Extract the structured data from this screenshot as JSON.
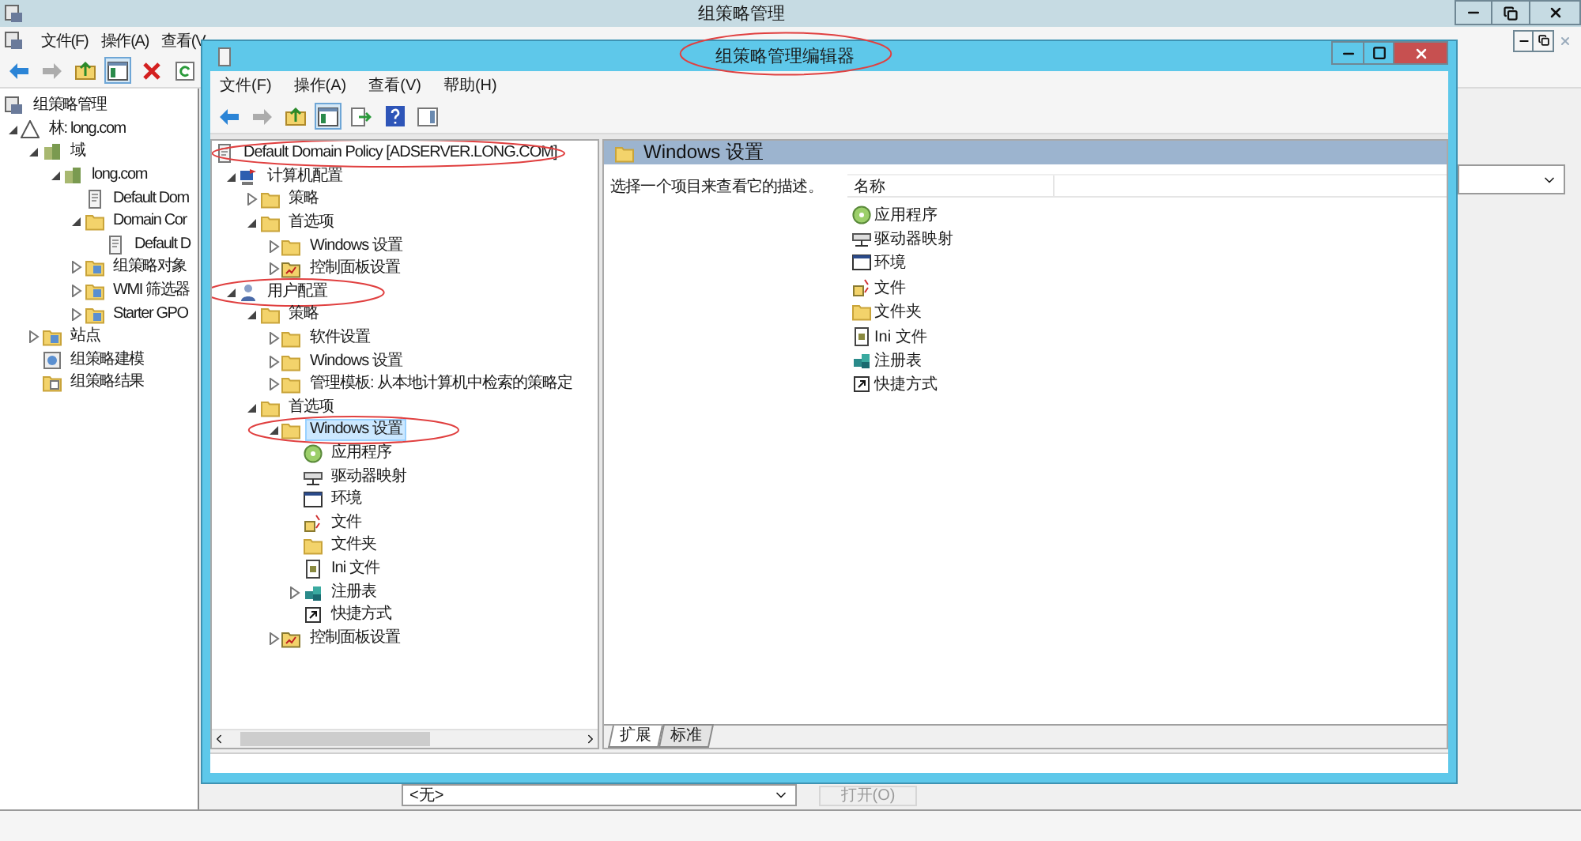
{
  "background_window": {
    "title": "组策略管理",
    "menu": [
      "文件(F)",
      "操作(A)",
      "查看(V"
    ],
    "toolbar": [
      {
        "kind": "back",
        "disabled": false,
        "pressed": false
      },
      {
        "kind": "forward",
        "disabled": true,
        "pressed": false
      },
      {
        "kind": "up",
        "disabled": false,
        "pressed": false
      },
      {
        "kind": "tree",
        "disabled": false,
        "pressed": true
      },
      {
        "kind": "delete",
        "disabled": false,
        "pressed": false
      },
      {
        "kind": "refresh",
        "disabled": false,
        "pressed": false
      }
    ],
    "tree": [
      {
        "label": "组策略管理",
        "kind": "console",
        "children": [
          {
            "label": "林: long.com",
            "kind": "forest",
            "expanded": true,
            "children": [
              {
                "label": "域",
                "kind": "domains",
                "expanded": true,
                "children": [
                  {
                    "label": "long.com",
                    "kind": "domain",
                    "expanded": true,
                    "children": [
                      {
                        "label": "Default Dom",
                        "kind": "gpo-link"
                      },
                      {
                        "label": "Domain Cor",
                        "kind": "ou",
                        "expanded": true,
                        "children": [
                          {
                            "label": "Default D",
                            "kind": "gpo-link"
                          }
                        ]
                      },
                      {
                        "label": "组策略对象",
                        "kind": "gpo-folder",
                        "expanded": false
                      },
                      {
                        "label": "WMI 筛选器",
                        "kind": "wmi",
                        "expanded": false
                      },
                      {
                        "label": "Starter GPO",
                        "kind": "starter",
                        "expanded": false
                      }
                    ]
                  }
                ]
              },
              {
                "label": "站点",
                "kind": "sites",
                "expanded": false
              },
              {
                "label": "组策略建模",
                "kind": "modeling"
              },
              {
                "label": "组策略结果",
                "kind": "results"
              }
            ]
          }
        ]
      }
    ],
    "filter_select": {
      "value": "<无>"
    },
    "open_button": {
      "label": "打开(O)",
      "disabled": true
    }
  },
  "editor_window": {
    "title": {
      "text": "组策略管理编辑器",
      "circled": true
    },
    "menu": [
      "文件(F)",
      "操作(A)",
      "查看(V)",
      "帮助(H)"
    ],
    "toolbar": [
      {
        "kind": "back",
        "disabled": false,
        "pressed": false
      },
      {
        "kind": "forward",
        "disabled": true,
        "pressed": false
      },
      {
        "kind": "up",
        "disabled": false,
        "pressed": false
      },
      {
        "kind": "tree",
        "disabled": false,
        "pressed": true
      },
      {
        "kind": "export",
        "disabled": false,
        "pressed": false
      },
      {
        "kind": "help",
        "disabled": false,
        "pressed": false
      },
      {
        "kind": "pane",
        "disabled": false,
        "pressed": false
      }
    ],
    "tree": [
      {
        "label": "Default Domain Policy [ADSERVER.LONG.COM]",
        "kind": "policy",
        "selected": false,
        "circled": true,
        "children": [
          {
            "label": "计算机配置",
            "kind": "computer",
            "expanded": true,
            "selected": false,
            "children": [
              {
                "label": "策略",
                "kind": "folder",
                "expanded": false,
                "selected": false
              },
              {
                "label": "首选项",
                "kind": "folder",
                "expanded": true,
                "selected": false,
                "children": [
                  {
                    "label": "Windows 设置",
                    "kind": "folder",
                    "expanded": false,
                    "selected": false
                  },
                  {
                    "label": "控制面板设置",
                    "kind": "control-panel",
                    "expanded": false,
                    "selected": false
                  }
                ]
              }
            ]
          },
          {
            "label": "用户配置",
            "kind": "user",
            "expanded": true,
            "selected": false,
            "circled": true,
            "children": [
              {
                "label": "策略",
                "kind": "folder",
                "expanded": true,
                "selected": false,
                "children": [
                  {
                    "label": "软件设置",
                    "kind": "folder",
                    "expanded": false,
                    "selected": false
                  },
                  {
                    "label": "Windows 设置",
                    "kind": "folder",
                    "expanded": false,
                    "selected": false
                  },
                  {
                    "label": "管理模板: 从本地计算机中检索的策略定",
                    "kind": "folder",
                    "expanded": false,
                    "selected": false
                  }
                ]
              },
              {
                "label": "首选项",
                "kind": "folder",
                "expanded": true,
                "selected": false,
                "children": [
                  {
                    "label": "Windows 设置",
                    "kind": "folder",
                    "expanded": true,
                    "selected": true,
                    "circled": true,
                    "children": [
                      {
                        "label": "应用程序",
                        "kind": "app",
                        "selected": false
                      },
                      {
                        "label": "驱动器映射",
                        "kind": "drive",
                        "selected": false
                      },
                      {
                        "label": "环境",
                        "kind": "env",
                        "selected": false
                      },
                      {
                        "label": "文件",
                        "kind": "file",
                        "selected": false
                      },
                      {
                        "label": "文件夹",
                        "kind": "folder-item",
                        "selected": false
                      },
                      {
                        "label": "Ini 文件",
                        "kind": "ini",
                        "selected": false
                      },
                      {
                        "label": "注册表",
                        "kind": "registry",
                        "expanded": false,
                        "selected": false
                      },
                      {
                        "label": "快捷方式",
                        "kind": "shortcut",
                        "selected": false
                      }
                    ]
                  },
                  {
                    "label": "控制面板设置",
                    "kind": "control-panel",
                    "expanded": false,
                    "selected": false
                  }
                ]
              }
            ]
          }
        ]
      }
    ],
    "details": {
      "header": "Windows 设置",
      "description": "选择一个项目来查看它的描述。",
      "column": "名称",
      "items": [
        {
          "label": "应用程序",
          "kind": "app"
        },
        {
          "label": "驱动器映射",
          "kind": "drive"
        },
        {
          "label": "环境",
          "kind": "env"
        },
        {
          "label": "文件",
          "kind": "file"
        },
        {
          "label": "文件夹",
          "kind": "folder-item"
        },
        {
          "label": "Ini 文件",
          "kind": "ini"
        },
        {
          "label": "注册表",
          "kind": "registry"
        },
        {
          "label": "快捷方式",
          "kind": "shortcut"
        }
      ]
    },
    "tabs": [
      {
        "label": "扩展",
        "selected": true
      },
      {
        "label": "标准",
        "selected": false
      }
    ]
  }
}
